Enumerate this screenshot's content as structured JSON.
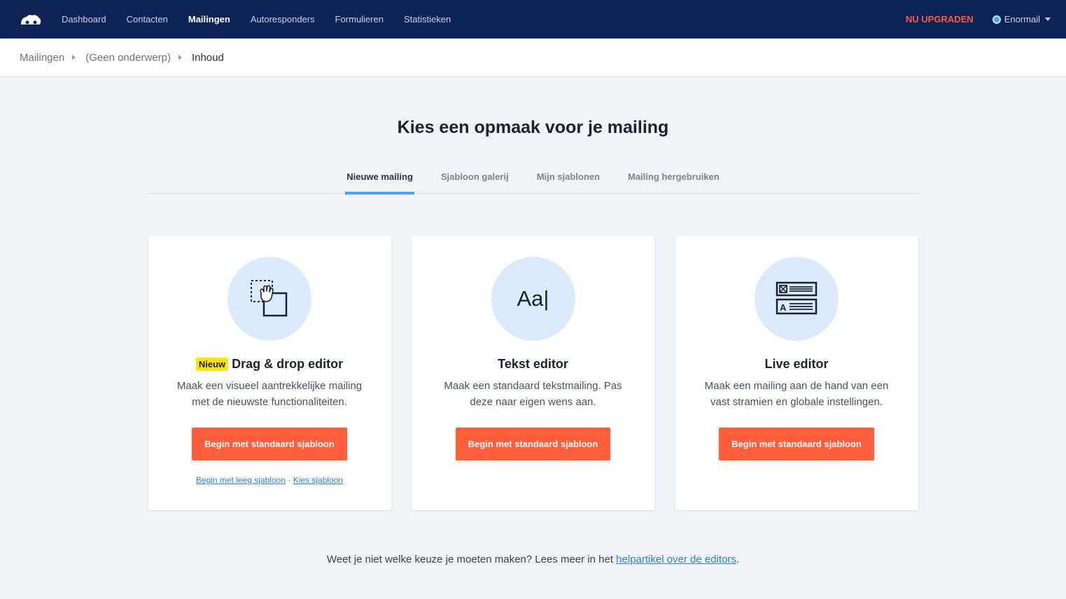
{
  "nav": {
    "items": [
      {
        "label": "Dashboard"
      },
      {
        "label": "Contacten"
      },
      {
        "label": "Mailingen"
      },
      {
        "label": "Autoresponders"
      },
      {
        "label": "Formulieren"
      },
      {
        "label": "Statistieken"
      }
    ],
    "active_item": "Mailingen",
    "upgrade_label": "NU UPGRADEN",
    "account_name": "Enormail"
  },
  "breadcrumb": {
    "items": [
      "Mailingen",
      "(Geen onderwerp)",
      "Inhoud"
    ]
  },
  "page": {
    "title": "Kies een opmaak voor je mailing"
  },
  "tabs": [
    {
      "label": "Nieuwe mailing"
    },
    {
      "label": "Sjabloon galerij"
    },
    {
      "label": "Mijn sjablonen"
    },
    {
      "label": "Mailing hergebruiken"
    }
  ],
  "active_tab": "Nieuwe mailing",
  "cards": [
    {
      "icon": "drag-drop-icon",
      "badge": "Nieuw",
      "title": "Drag & drop editor",
      "description": "Maak een visueel aantrekkelijke mailing met de nieuwste functionaliteiten.",
      "button": "Begin met standaard sjabloon",
      "link_empty": "Begin met leeg sjabloon",
      "link_separator": "·",
      "link_choose": "Kies sjabloon"
    },
    {
      "icon": "text-editor-icon",
      "icon_text": "Aa|",
      "title": "Tekst editor",
      "description": "Maak een standaard tekstmailing. Pas deze naar eigen wens aan.",
      "button": "Begin met standaard sjabloon"
    },
    {
      "icon": "live-editor-icon",
      "title": "Live editor",
      "description": "Maak een mailing aan de hand van een vast stramien en globale instellingen.",
      "button": "Begin met standaard sjabloon"
    }
  ],
  "footer": {
    "text": "Weet je niet welke keuze je moeten maken? Lees meer in het ",
    "link": "helpartikel over de editors",
    "suffix": "."
  },
  "colors": {
    "topbar": "#0d2357",
    "accent_button": "#ff5d3c",
    "upgrade": "#ff5a36",
    "tab_underline": "#4a9ff0",
    "icon_circle": "#dcebfb",
    "badge": "#ffe500"
  }
}
